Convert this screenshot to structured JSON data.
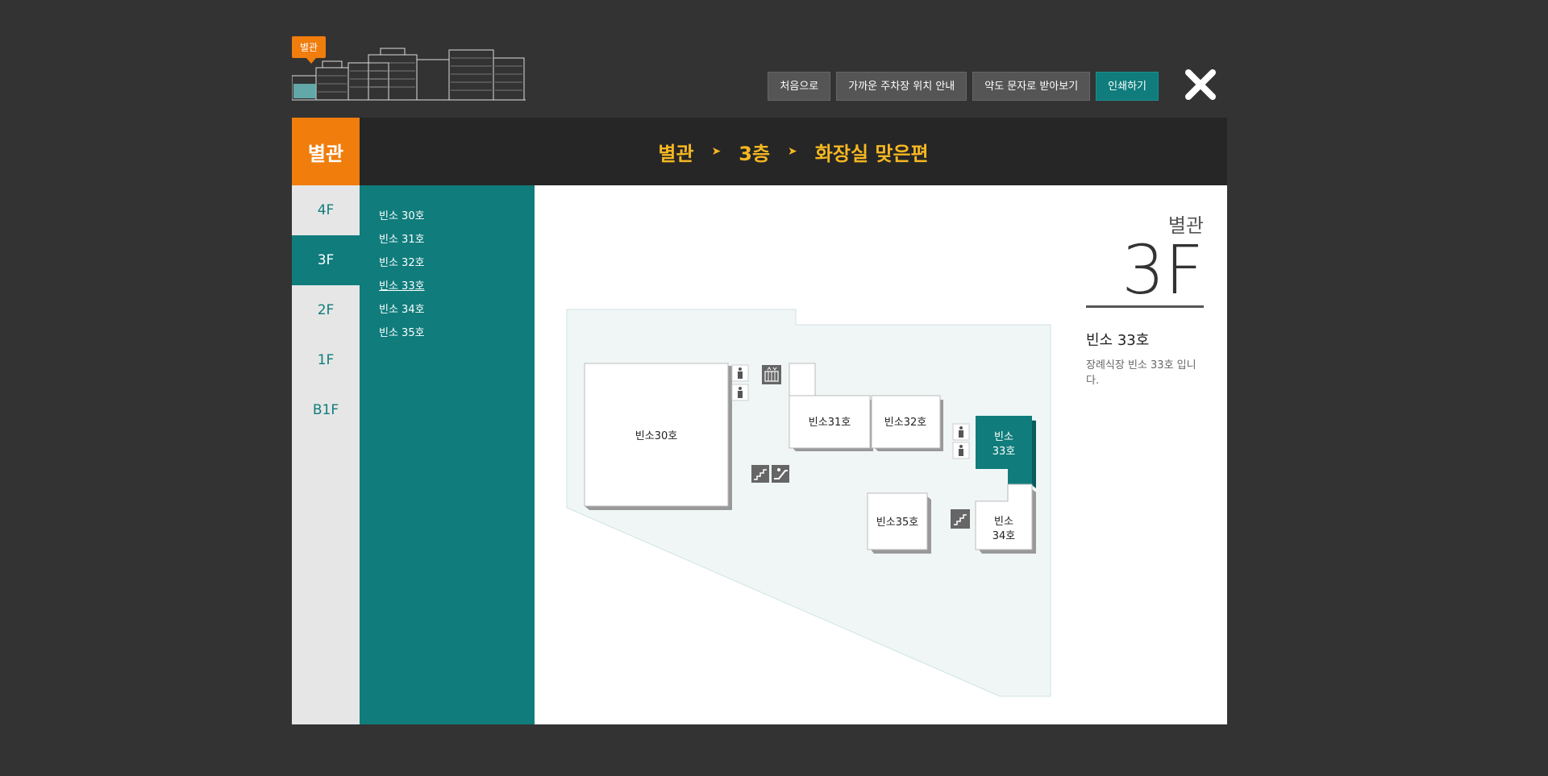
{
  "top": {
    "building_badge": "별관",
    "buttons": {
      "home": "처음으로",
      "parking": "가까운 주차장 위치 안내",
      "sms": "약도 문자로 받아보기",
      "print": "인쇄하기"
    }
  },
  "header": {
    "building": "별관",
    "breadcrumb": {
      "building": "별관",
      "floor": "3층",
      "location": "화장실 맞은편"
    }
  },
  "floors": [
    "4F",
    "3F",
    "2F",
    "1F",
    "B1F"
  ],
  "active_floor": "3F",
  "rooms": [
    "빈소 30호",
    "빈소 31호",
    "빈소 32호",
    "빈소 33호",
    "빈소 34호",
    "빈소 35호"
  ],
  "active_room": "빈소 33호",
  "map": {
    "room30": "빈소30호",
    "room31": "빈소31호",
    "room32": "빈소32호",
    "room33_a": "빈소",
    "room33_b": "33호",
    "room34_a": "빈소",
    "room34_b": "34호",
    "room35": "빈소35호"
  },
  "info": {
    "building": "별관",
    "floor": "3F",
    "room_title": "빈소 33호",
    "description": "장례식장 빈소 33호 입니다."
  },
  "colors": {
    "accent_orange": "#f07d0c",
    "teal": "#107c7c",
    "breadcrumb_yellow": "#f6b722"
  }
}
